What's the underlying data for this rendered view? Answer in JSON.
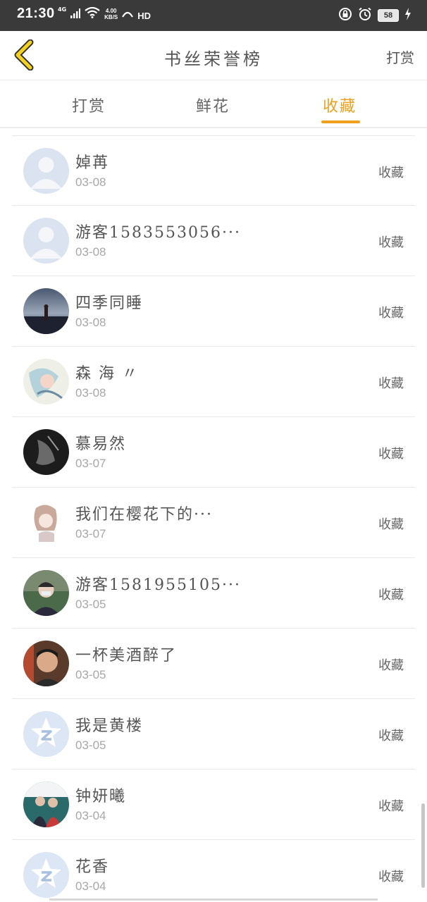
{
  "status_bar": {
    "time": "21:30",
    "network": "4G",
    "speed_value": "4.00",
    "speed_unit": "KB/S",
    "hd": "HD",
    "battery": "58"
  },
  "nav": {
    "title": "书丝荣誉榜",
    "action_label": "打赏"
  },
  "tabs": [
    {
      "label": "打赏"
    },
    {
      "label": "鲜花"
    },
    {
      "label": "收藏",
      "active": true
    }
  ],
  "colors": {
    "accent": "#f0a01e",
    "status_bar": "#3a3a3a"
  },
  "list": [
    {
      "name": "婥苒",
      "date": "03-08",
      "action": "收藏",
      "avatar": "default-person"
    },
    {
      "name": "游客1583553056···",
      "date": "03-08",
      "action": "收藏",
      "avatar": "default-person"
    },
    {
      "name": "四季同睡",
      "date": "03-08",
      "action": "收藏",
      "avatar": "photo-night-figure"
    },
    {
      "name": "森 海 〃",
      "date": "03-08",
      "action": "收藏",
      "avatar": "photo-illustration-girl"
    },
    {
      "name": "慕易然",
      "date": "03-07",
      "action": "收藏",
      "avatar": "photo-dark"
    },
    {
      "name": "我们在樱花下的···",
      "date": "03-07",
      "action": "收藏",
      "avatar": "photo-anime-girl"
    },
    {
      "name": "游客1581955105···",
      "date": "03-05",
      "action": "收藏",
      "avatar": "photo-person-mask"
    },
    {
      "name": "一杯美酒醉了",
      "date": "03-05",
      "action": "收藏",
      "avatar": "photo-man"
    },
    {
      "name": "我是黄楼",
      "date": "03-05",
      "action": "收藏",
      "avatar": "qzone-star"
    },
    {
      "name": "钟妍曦",
      "date": "03-04",
      "action": "收藏",
      "avatar": "photo-couple"
    },
    {
      "name": "花香",
      "date": "03-04",
      "action": "收藏",
      "avatar": "qzone-star"
    }
  ]
}
